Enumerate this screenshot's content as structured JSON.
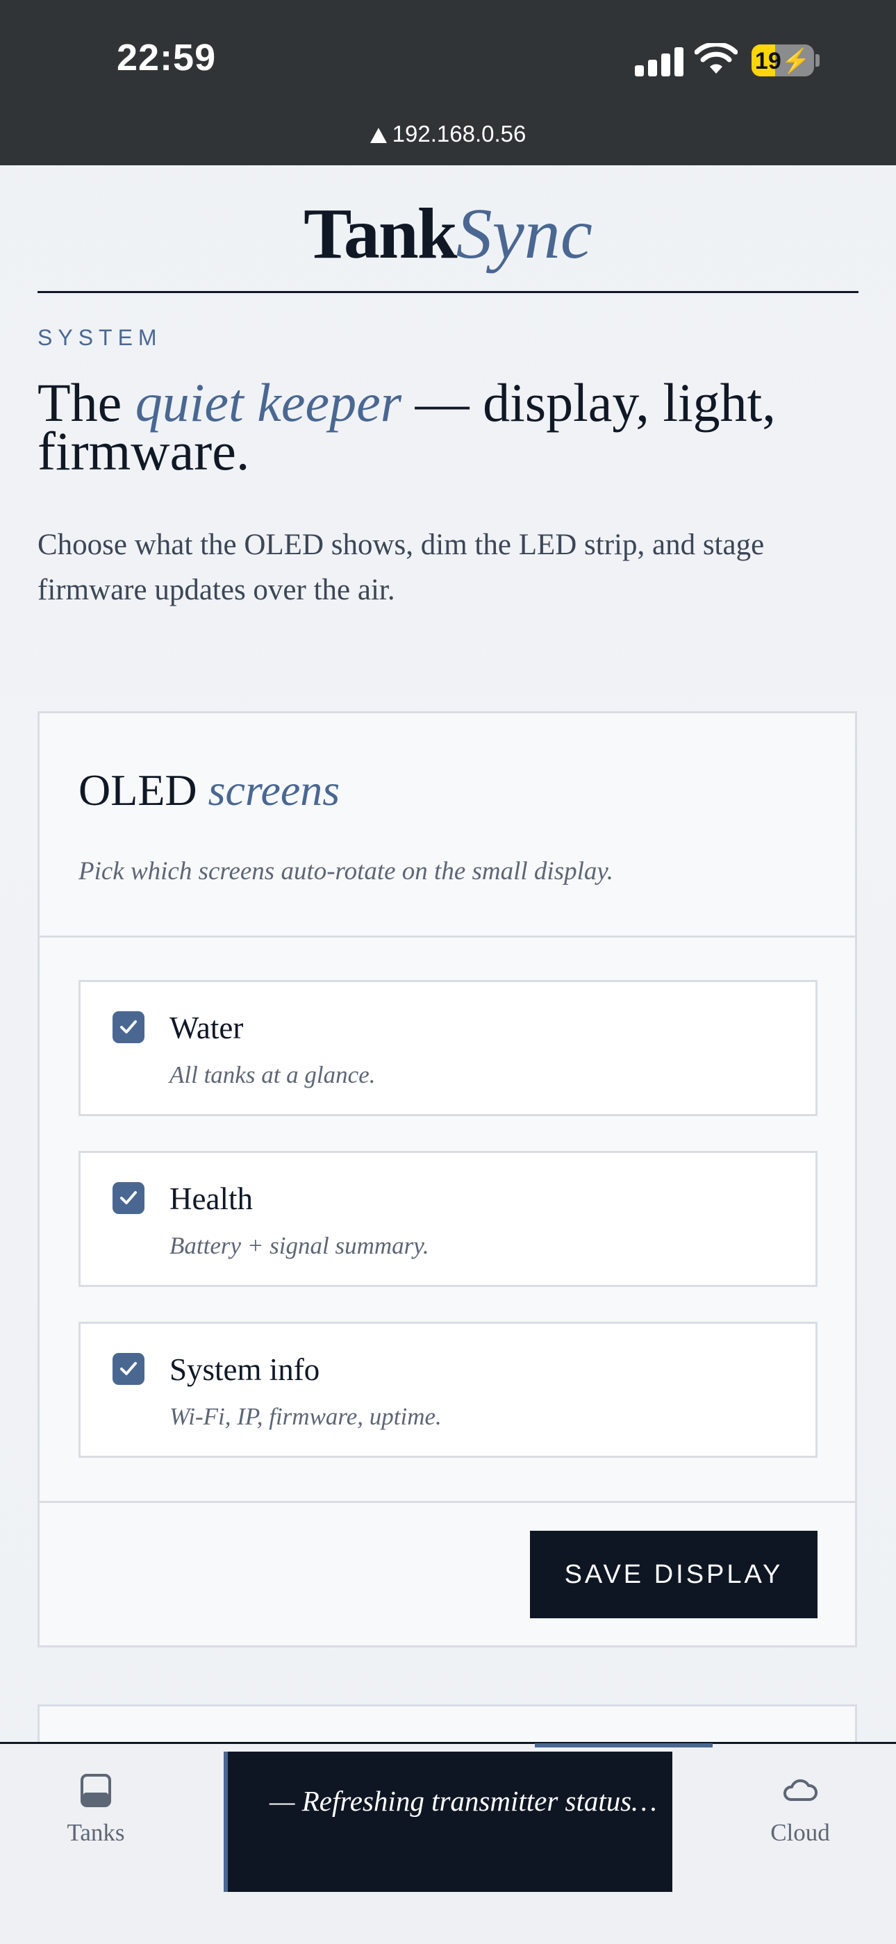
{
  "status_bar": {
    "time": "22:59",
    "battery": "19",
    "url": "192.168.0.56",
    "icons": [
      "signal-icon",
      "wifi-icon",
      "battery-icon",
      "warning-icon"
    ]
  },
  "brand": {
    "part1": "Tank",
    "part2": "Sync"
  },
  "intro": {
    "eyebrow": "SYSTEM",
    "headline_pre": "The ",
    "headline_em": "quiet keeper",
    "headline_post": " — display, light, firmware.",
    "lead": "Choose what the OLED shows, dim the LED strip, and stage firmware updates over the air."
  },
  "oled_card": {
    "title_plain": "OLED ",
    "title_em": "screens",
    "subtitle": "Pick which screens auto-rotate on the small display.",
    "options": [
      {
        "label": "Water",
        "desc": "All tanks at a glance.",
        "checked": true
      },
      {
        "label": "Health",
        "desc": "Battery + signal summary.",
        "checked": true
      },
      {
        "label": "System info",
        "desc": "Wi-Fi, IP, firmware, uptime.",
        "checked": true
      }
    ],
    "save_label": "SAVE DISPLAY"
  },
  "bottom_nav": {
    "items": [
      {
        "label": "Tanks",
        "icon": "tank-icon"
      },
      {
        "label": "Cloud",
        "icon": "cloud-icon"
      }
    ]
  },
  "toast": {
    "text": "— Refreshing transmitter status…"
  },
  "colors": {
    "accent": "#4a6792",
    "ink": "#0f1623",
    "muted": "#5d6675"
  }
}
